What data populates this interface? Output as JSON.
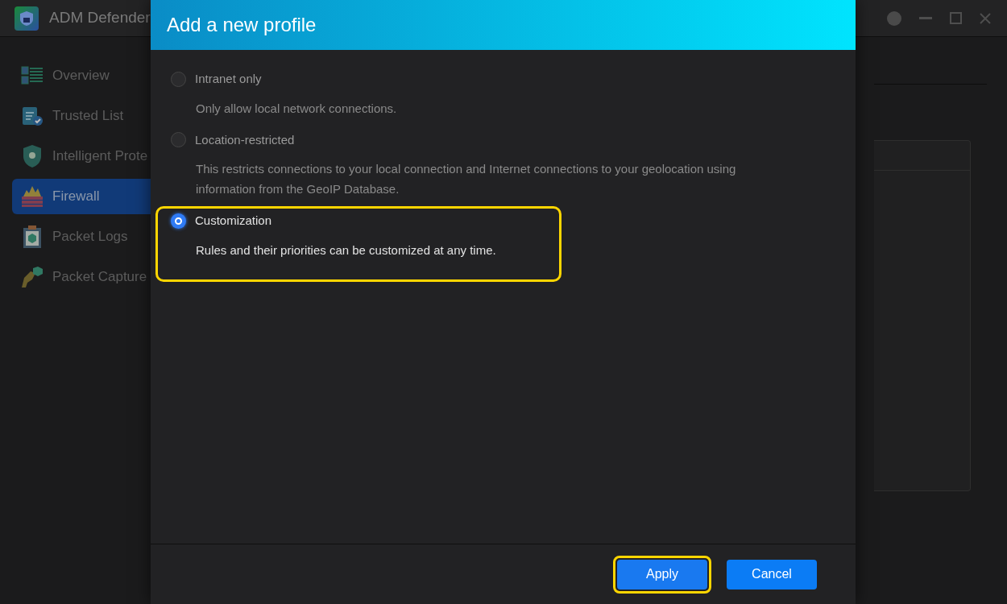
{
  "app": {
    "title": "ADM Defender"
  },
  "sidebar": {
    "items": [
      {
        "label": "Overview",
        "kind": "overview",
        "selected": false
      },
      {
        "label": "Trusted List",
        "kind": "trusted",
        "selected": false
      },
      {
        "label": "Intelligent Prote",
        "kind": "shield",
        "selected": false
      },
      {
        "label": "Firewall",
        "kind": "firewall",
        "selected": true
      },
      {
        "label": "Packet Logs",
        "kind": "logs",
        "selected": false
      },
      {
        "label": "Packet Capture",
        "kind": "capture",
        "selected": false
      }
    ]
  },
  "dialog": {
    "title": "Add a new profile",
    "options": [
      {
        "label": "Intranet only",
        "description": "Only allow local network connections.",
        "selected": false,
        "highlighted": false
      },
      {
        "label": "Location-restricted",
        "description": "This restricts connections to your local connection and Internet connections to your geolocation using information from the GeoIP Database.",
        "selected": false,
        "highlighted": false
      },
      {
        "label": "Customization",
        "description": "Rules and their priorities can be customized at any time.",
        "selected": true,
        "highlighted": true
      }
    ],
    "buttons": [
      {
        "label": "Apply",
        "kind": "primary",
        "highlighted": true
      },
      {
        "label": "Cancel",
        "kind": "secondary",
        "highlighted": false
      }
    ]
  }
}
